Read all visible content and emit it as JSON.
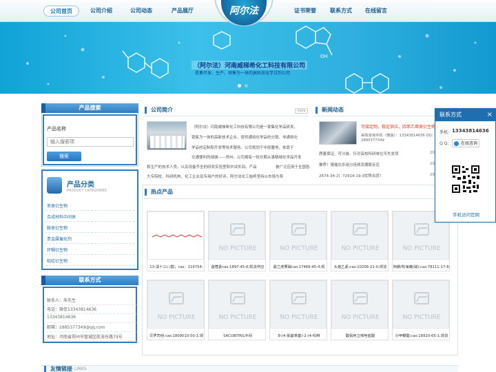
{
  "nav": {
    "left": [
      "公司首页",
      "公司介绍",
      "公司动态",
      "产品展厅"
    ],
    "right": [
      "证书荣誉",
      "联系方式",
      "在线留言"
    ],
    "logo": "阿尔法"
  },
  "banner": {
    "title": "（阿尔法）河南威梯希化工科技有限公司",
    "subtitle": "是集开发、生产、销售为一体的高科技化学试剂公司"
  },
  "search": {
    "header": "产品搜索",
    "label": "产品名称",
    "placeholder": "输入搜索项",
    "button": "搜索"
  },
  "categories": {
    "title": "产品分类",
    "subtitle": "PRODUCT CATEGORIES",
    "items": [
      "苯类衍生物",
      "合成材料中间体",
      "胺类衍生物",
      "贵金属催化剂",
      "环糊衍生物",
      "吡啶衍生物"
    ]
  },
  "contact": {
    "header": "联系方式",
    "lines": [
      "联系人：朱先生",
      "电话：微信13343814636",
      "13343814636",
      "邮箱：2885377349@qq.com",
      "地址：河南省郑州市管城区航海东路79号"
    ]
  },
  "intro": {
    "title": "公司简介",
    "more": "more",
    "text1": "（阿尔法）河南威梯希化工科技有限公司是一家集化学品研发、",
    "text2": "销售为一体的高新技术企业，提供通用化学品的分销、非通用化",
    "text3": "学品的定制和开发等技术服务。公司规划于中原腹地，依靠于",
    "text4": "交通便利的绿城——郑州。公司拥有一批长期从事精细化学品开发",
    "text5": "和生产的技术人员，以及设备齐全的研发实验室和中试车间。产品",
    "text6": "大专院校、科研机构、化工企业及专用户的好评。阿尔法化工始终坚持以市场为导",
    "text7": "被广泛应用于全国各"
  },
  "news": {
    "title": "新闻动态",
    "headline": "可接定制，稳定供应，四苯乙烯类衍生物",
    "sub1": "采购咨询手机（微信）：13343814636 QQ：",
    "sub2": "2885377349",
    "items": [
      {
        "text": "质量保证、可分装、针对高校科研单位可先发货",
        "date": "20"
      },
      {
        "text": "推荐！镍催化杀组分连续流偶联反应",
        "date": "20"
      },
      {
        "text": "2674-34-2）72914-19-3优势出货！",
        "date": "20"
      }
    ]
  },
  "hot": {
    "title": "热点产品",
    "no_picture": "NO PICTURE",
    "products": [
      "13-溴十三(-)醇；cas：116754-",
      "苜蓿素cas:1897-45-6;现货供应",
      "嘉兰虎栗碱cas:17466-45-4;现",
      "头孢乙素;cas:10206-21-0;现货",
      "阿朗/牧海嗪(碱);cas:78111-17-8;",
      "贝罗司他;cas:1809010-50-1;现",
      "SACUBITRIL中间",
      "8-(4-氯基苯基)-2-(4-吗啉",
      "酸氨阿立哌唑盐酸",
      "沙甲鞭酸;cas:18910-65-1;现货"
    ]
  },
  "footer": {
    "links": "友情链接",
    "links_en": "LINKS"
  },
  "float": {
    "title": "联系方式",
    "close": "×",
    "phone_label": "手机:",
    "phone": "13343814636",
    "qq_label": "Q Q:",
    "qq_button": "在线咨询",
    "mobile": "手机访问官网"
  },
  "colors": {
    "accent": "#2f7cc0",
    "banner": "#2fb0e0",
    "title": "#1b5f8e"
  }
}
